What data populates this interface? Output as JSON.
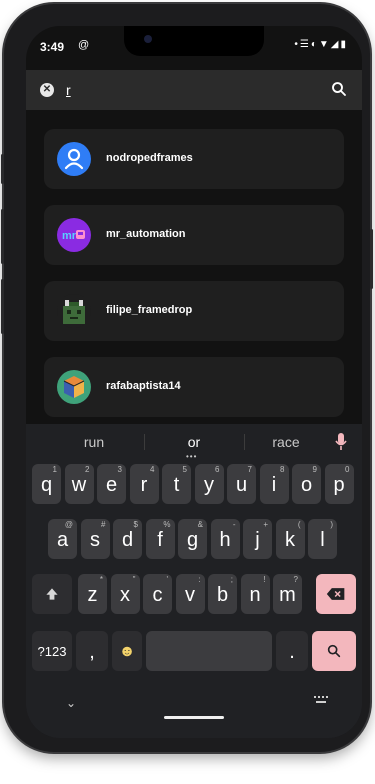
{
  "status": {
    "time": "3:49"
  },
  "search": {
    "value": "r",
    "placeholder": ""
  },
  "results": [
    {
      "name": "nodropedframes",
      "avatar_color": "#2f7df6",
      "avatar_icon": "person-icon"
    },
    {
      "name": "mr_automation",
      "avatar_color": "#8a2be2",
      "avatar_icon": "mr-logo-icon"
    },
    {
      "name": "filipe_framedrop",
      "avatar_color": "#3e6b3a",
      "avatar_icon": "pixel-creature-icon"
    },
    {
      "name": "rafabaptista14",
      "avatar_color": "#3fa27a",
      "avatar_icon": "cube-icon"
    }
  ],
  "keyboard": {
    "suggestions": [
      "run",
      "or",
      "race"
    ],
    "row1": [
      {
        "k": "q",
        "h": "1"
      },
      {
        "k": "w",
        "h": "2"
      },
      {
        "k": "e",
        "h": "3"
      },
      {
        "k": "r",
        "h": "4"
      },
      {
        "k": "t",
        "h": "5"
      },
      {
        "k": "y",
        "h": "6"
      },
      {
        "k": "u",
        "h": "7"
      },
      {
        "k": "i",
        "h": "8"
      },
      {
        "k": "o",
        "h": "9"
      },
      {
        "k": "p",
        "h": "0"
      }
    ],
    "row2": [
      {
        "k": "a",
        "h": "@"
      },
      {
        "k": "s",
        "h": "#"
      },
      {
        "k": "d",
        "h": "$"
      },
      {
        "k": "f",
        "h": "%"
      },
      {
        "k": "g",
        "h": "&"
      },
      {
        "k": "h",
        "h": "-"
      },
      {
        "k": "j",
        "h": "+"
      },
      {
        "k": "k",
        "h": "("
      },
      {
        "k": "l",
        "h": ")"
      }
    ],
    "row3": [
      {
        "k": "z",
        "h": "*"
      },
      {
        "k": "x",
        "h": "\""
      },
      {
        "k": "c",
        "h": "'"
      },
      {
        "k": "v",
        "h": ":"
      },
      {
        "k": "b",
        "h": ";"
      },
      {
        "k": "n",
        "h": "!"
      },
      {
        "k": "m",
        "h": "?"
      }
    ],
    "sym_label": "?123",
    "comma": ",",
    "period": ".",
    "emoji": "☻"
  },
  "colors": {
    "accent": "#f3b7bd",
    "background": "#121212",
    "card": "#1f1f1f"
  }
}
